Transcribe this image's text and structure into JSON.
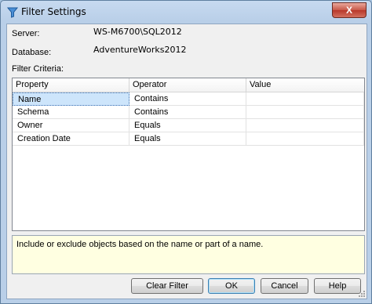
{
  "window": {
    "title": "Filter Settings",
    "close_label": "X"
  },
  "info": {
    "server_label": "Server:",
    "server_value": "WS-M6700\\SQL2012",
    "database_label": "Database:",
    "database_value": "AdventureWorks2012",
    "criteria_label": "Filter Criteria:"
  },
  "grid": {
    "columns": [
      "Property",
      "Operator",
      "Value"
    ],
    "rows": [
      {
        "property": "Name",
        "operator": "Contains",
        "value": ""
      },
      {
        "property": "Schema",
        "operator": "Contains",
        "value": ""
      },
      {
        "property": "Owner",
        "operator": "Equals",
        "value": ""
      },
      {
        "property": "Creation Date",
        "operator": "Equals",
        "value": ""
      }
    ],
    "selected_row": 0
  },
  "description": "Include or exclude objects based on the name or part of a name.",
  "buttons": {
    "clear_filter": "Clear Filter",
    "ok": "OK",
    "cancel": "Cancel",
    "help": "Help"
  },
  "colors": {
    "selection": "#cde5fb",
    "description_bg": "#ffffe1",
    "close_button": "#c75848"
  },
  "icons": {
    "title": "filter-funnel-icon",
    "close": "close-icon",
    "resize": "resize-grip-icon"
  }
}
